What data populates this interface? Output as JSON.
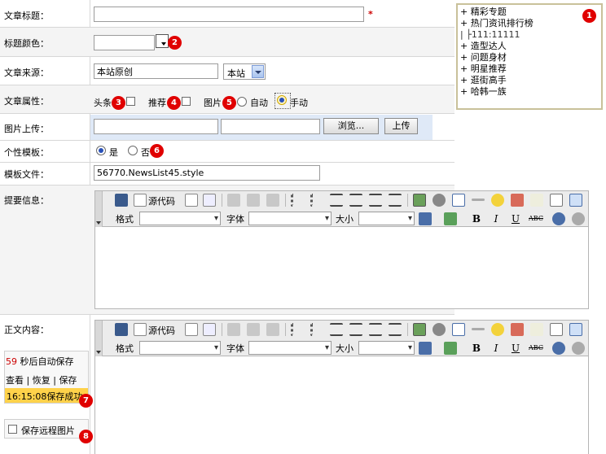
{
  "labels": {
    "title": "文章标题：",
    "color": "标题颜色：",
    "source": "文章来源：",
    "attr": "文章属性：",
    "image": "图片上传：",
    "template": "个性模板：",
    "template_file": "模板文件：",
    "summary": "提要信息：",
    "content": "正文内容："
  },
  "required_mark": "*",
  "source": {
    "value": "本站原创",
    "select": "本站"
  },
  "attributes": {
    "headline": "头条",
    "recommend": "推荐",
    "image": "图片",
    "auto": "自动",
    "manual": "手动"
  },
  "upload": {
    "browse": "浏览...",
    "upload": "上传"
  },
  "template": {
    "yes": "是",
    "no": "否",
    "file": "56770.NewsList45.style"
  },
  "categories": [
    "+ 精彩专题",
    "+ 热门资讯排行榜",
    "|  ├111:11111",
    "+ 造型达人",
    "+ 问题身材",
    "+ 明星推荐",
    "+ 逛街高手",
    "+ 哈韩一族"
  ],
  "toolbar": {
    "source": "源代码",
    "format": "格式",
    "font": "字体",
    "size": "大小",
    "bold": "B",
    "italic": "I",
    "underline": "U",
    "strike": "ABC"
  },
  "autosave": {
    "countdown": "59",
    "countdown_text": "秒后自动保存",
    "view": "查看",
    "restore": "恢复",
    "save": "保存",
    "sep": "|",
    "saved": "16:15:08保存成功",
    "remote": "保存远程图片"
  },
  "markers": [
    "1",
    "2",
    "3",
    "4",
    "5",
    "6",
    "7",
    "8"
  ],
  "colors": {
    "marker": "#e00000",
    "required": "#cc0000",
    "countdown": "#cc0000",
    "saved_bg": "#ffd24a",
    "upload_bg": "#dfe9f7"
  }
}
